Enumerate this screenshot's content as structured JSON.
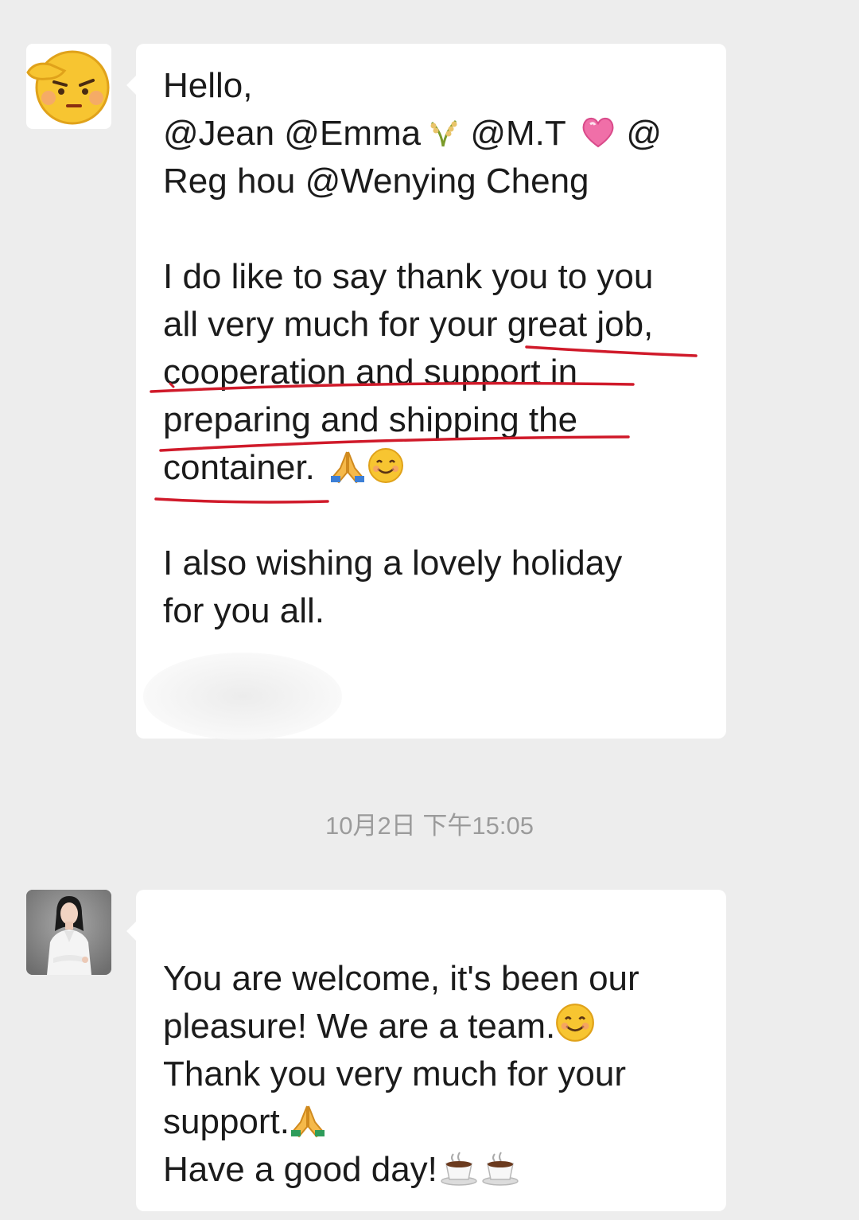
{
  "messages": [
    {
      "sender_avatar": "salute-emoji-avatar",
      "lines": {
        "l1": "Hello,",
        "l2": " @Jean @Emma",
        "l2b": " @M.T ",
        "l2c": " @",
        "l3": "Reg hou @Wenying Cheng",
        "l4": "I do like to say thank you to you",
        "l5": "all very much for your great job,",
        "l6": "cooperation and support in",
        "l7": "preparing and shipping the",
        "l8": "container. ",
        "l9": "I also wishing a lovely holiday",
        "l10": "for you all."
      }
    },
    {
      "sender_avatar": "woman-profile-photo",
      "lines": {
        "l1": "You are welcome, it's been our",
        "l2": "pleasure! We are a team.",
        "l3": "Thank you very much for your",
        "l4": "support.",
        "l5": "Have a good day!"
      }
    }
  ],
  "timestamp": "10月2日 下午15:05",
  "icons": [
    "salute-emoji-avatar",
    "rice-icon",
    "heart-icon",
    "pray-icon",
    "smile-icon",
    "coffee-icon"
  ],
  "colors": {
    "background": "#ededed",
    "bubble": "#ffffff",
    "underline": "#d01a2a",
    "timestamp": "#9b9b9b"
  }
}
